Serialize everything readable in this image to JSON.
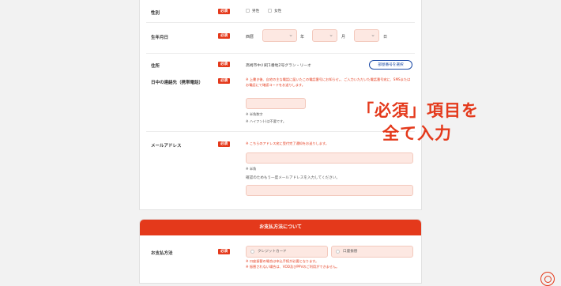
{
  "form": {
    "required_badge": "必須",
    "gender": {
      "label": "性別",
      "options": [
        "男性",
        "女性"
      ]
    },
    "birthday": {
      "label": "生年月日",
      "era": "西暦",
      "year_unit": "年",
      "month_unit": "月",
      "day_unit": "日"
    },
    "address": {
      "label": "住所",
      "value": "高崎市中川町1番地2号グラン・リーオ",
      "room_button": "部屋番号を選択"
    },
    "phone": {
      "label": "日中の連絡先（携帯電話）",
      "note": "※ 上書き後、自宅の主な電話に届いたこの電話番号にお知らせ。、ご入力いただいた電話番号宛に、SMSまたはお電話にて確認コードをお送りします。",
      "hints": [
        "※ 半角数字",
        "※ ハイフン(-)は不要です。"
      ]
    },
    "email": {
      "label": "メールアドレス",
      "note": "※ こちらのアドレス宛に受付完了通知をお送りします。",
      "hint": "※ 半角",
      "confirm_label": "確認のためもう一度メールアドレスを入力してください。"
    }
  },
  "payment": {
    "section_title": "お支払方法について",
    "label": "お支払方法",
    "options": [
      "クレジットカード",
      "口座振替"
    ],
    "notes": [
      "※ 口座振替の場合は申込手続が必要となります。",
      "※ 振替されない場合は、VOD及びPPVのご利用ができません。"
    ]
  },
  "overlay": {
    "line1": "「必須」項目を",
    "line2": "全て入力"
  },
  "colors": {
    "accent": "#e4391b",
    "input_bg": "#fde8e2",
    "link": "#1b4aa6"
  }
}
